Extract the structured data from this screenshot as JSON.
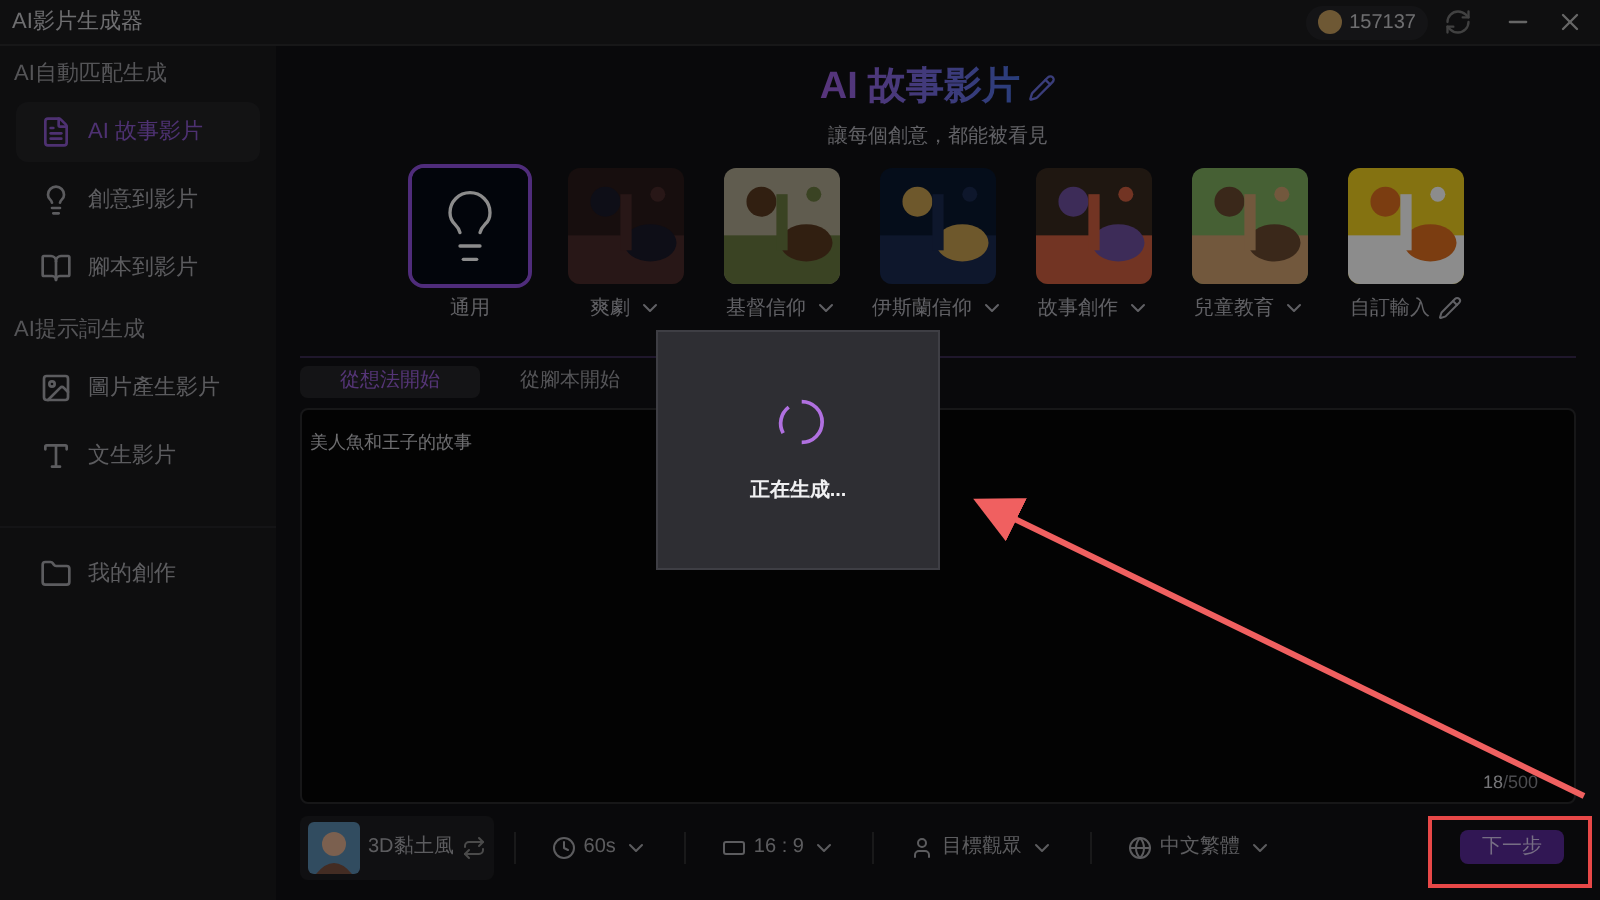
{
  "window": {
    "title": "AI影片生成器",
    "coins": "157137"
  },
  "sidebar": {
    "sections": [
      {
        "heading": "AI自動匹配生成",
        "items": [
          {
            "label": "AI 故事影片",
            "selected": true
          },
          {
            "label": "創意到影片",
            "selected": false
          },
          {
            "label": "腳本到影片",
            "selected": false
          }
        ]
      },
      {
        "heading": "AI提示詞生成",
        "items": [
          {
            "label": "圖片產生影片",
            "selected": false
          },
          {
            "label": "文生影片",
            "selected": false
          }
        ]
      }
    ],
    "footer_item": {
      "label": "我的創作",
      "selected": false
    }
  },
  "header": {
    "title": "AI 故事影片",
    "subtitle": "讓每個創意，都能被看見"
  },
  "templates": [
    {
      "label": "通用",
      "kind": "plain",
      "selected": true
    },
    {
      "label": "爽劇",
      "kind": "dropdown",
      "selected": false
    },
    {
      "label": "基督信仰",
      "kind": "dropdown",
      "selected": false
    },
    {
      "label": "伊斯蘭信仰",
      "kind": "dropdown",
      "selected": false
    },
    {
      "label": "故事創作",
      "kind": "dropdown",
      "selected": false
    },
    {
      "label": "兒童教育",
      "kind": "dropdown",
      "selected": false
    },
    {
      "label": "自訂輸入",
      "kind": "edit",
      "selected": false
    }
  ],
  "input_tabs": [
    {
      "label": "從想法開始",
      "selected": true
    },
    {
      "label": "從腳本開始",
      "selected": false
    }
  ],
  "prompt": {
    "value": "美人魚和王子的故事",
    "counter_used": "18",
    "counter_max": "/500"
  },
  "options": {
    "style": "3D黏土風",
    "duration": "60s",
    "ratio": "16 : 9",
    "audience": "目標觀眾",
    "language": "中文繁體"
  },
  "next_button": "下一步",
  "modal": {
    "message": "正在生成..."
  }
}
